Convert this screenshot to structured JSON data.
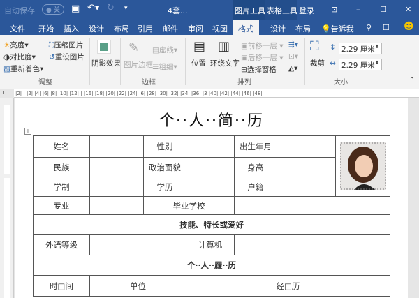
{
  "titlebar": {
    "autosave": "自动保存",
    "autosave_state": "关",
    "doc_title": "4套...",
    "context_tab1": "图片工具",
    "context_tab2": "表格工具",
    "login": "登录"
  },
  "tabs": [
    "文件",
    "开始",
    "插入",
    "设计",
    "布局",
    "引用",
    "邮件",
    "审阅",
    "视图",
    "格式",
    "设计",
    "布局"
  ],
  "tell_me": "告诉我",
  "ribbon": {
    "adjust": {
      "brightness": "亮度",
      "contrast": "对比度",
      "recolor": "重新着色",
      "compress": "压缩图片",
      "reset": "重设图片",
      "label": "调整"
    },
    "shadow": "阴影效果",
    "border": {
      "picture_border": "图片边框",
      "dashes": "虚线",
      "weight": "粗细",
      "label": "边框"
    },
    "arrange": {
      "position": "位置",
      "wrap": "环绕文字",
      "bring_forward": "前移一层",
      "send_backward": "后移一层",
      "selection_pane": "选择窗格",
      "label": "排列"
    },
    "size": {
      "crop": "裁剪",
      "height": "2.29 厘米",
      "width": "2.29 厘米",
      "label": "大小"
    }
  },
  "ruler": "|2|  |  |2| |4| |6|  |8| |10| |12|  |  |16| |18|  |20| |22| |24|  |6| |28| |30|  |32| |34| |36| |3  |40| |42| |44|  |46| |48|",
  "document": {
    "title": "个··人··简··历",
    "rows": {
      "name": "姓名",
      "gender": "性别",
      "birth": "出生年月",
      "ethnicity": "民族",
      "political": "政治面貌",
      "height": "身高",
      "schooling": "学制",
      "education": "学历",
      "hukou": "户籍",
      "major": "专业",
      "school": "毕业学校",
      "skills": "技能、特长或爱好",
      "language": "外语等级",
      "computer": "计算机",
      "resume": "个··人··履··历",
      "time": "时□间",
      "unit": "单位",
      "experience": "经□历"
    }
  }
}
